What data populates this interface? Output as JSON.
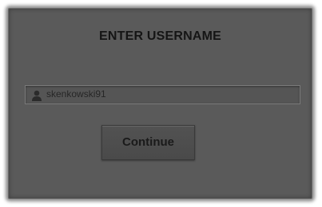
{
  "dialog": {
    "title": "ENTER USERNAME",
    "username_field": {
      "value": "skenkowski91",
      "icon": "user-icon"
    },
    "continue_label": "Continue"
  },
  "colors": {
    "panel": "#5a5a5a",
    "field_background": "#555555",
    "field_border": "#7a7a7a",
    "text": "#151515"
  }
}
